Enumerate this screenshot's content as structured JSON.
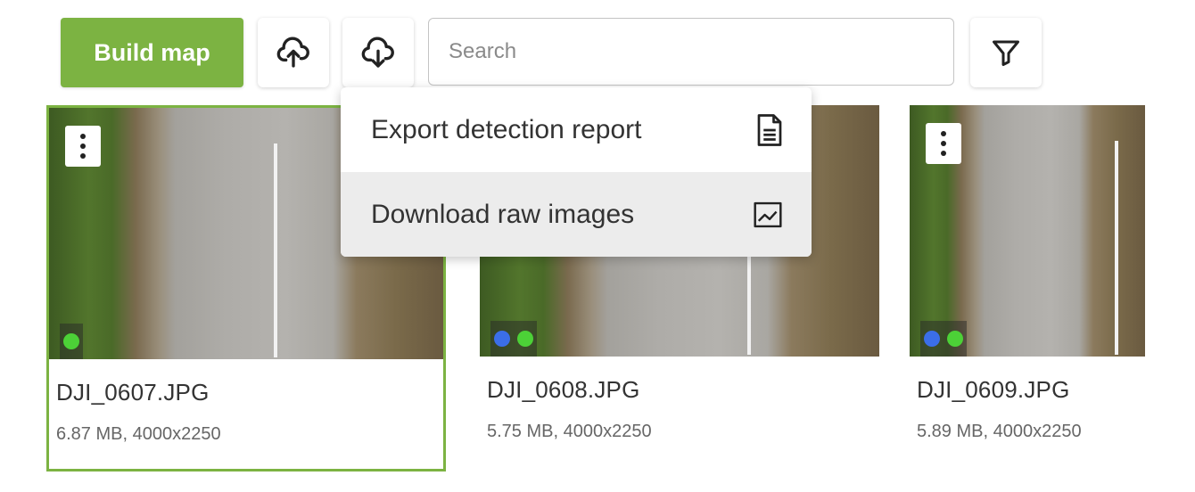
{
  "toolbar": {
    "build_label": "Build map",
    "search_placeholder": "Search"
  },
  "menu": {
    "items": [
      {
        "label": "Export detection report",
        "icon": "document-icon"
      },
      {
        "label": "Download raw images",
        "icon": "image-icon"
      }
    ]
  },
  "images": [
    {
      "name": "DJI_0607.JPG",
      "meta": "6.87 MB, 4000x2250",
      "selected": true,
      "status_dots": [
        "#4cd137"
      ]
    },
    {
      "name": "DJI_0608.JPG",
      "meta": "5.75 MB, 4000x2250",
      "selected": false,
      "status_dots": [
        "#3b6ee8",
        "#4cd137"
      ]
    },
    {
      "name": "DJI_0609.JPG",
      "meta": "5.89 MB, 4000x2250",
      "selected": false,
      "status_dots": [
        "#3b6ee8",
        "#4cd137"
      ]
    }
  ],
  "colors": {
    "accent": "#7cb342",
    "dot_blue": "#3b6ee8",
    "dot_green": "#4cd137"
  }
}
